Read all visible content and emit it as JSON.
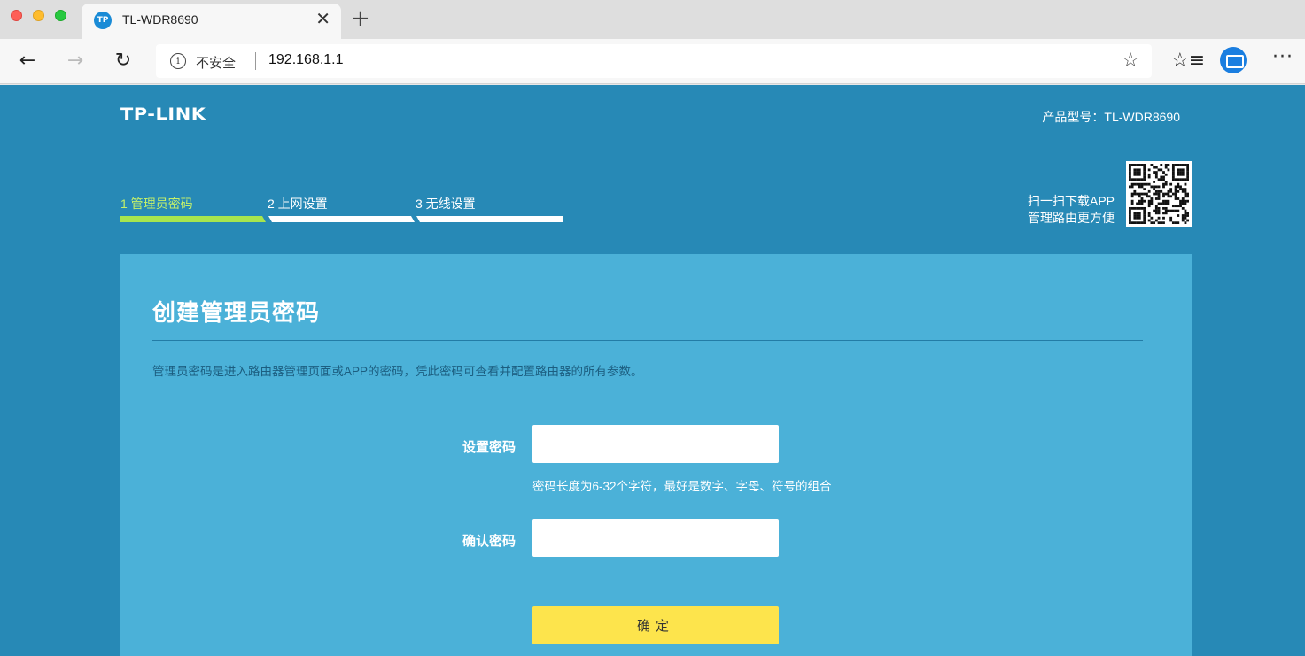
{
  "browser": {
    "tab_title": "TL-WDR8690",
    "tab_favicon_text": "TP",
    "close_glyph": "✕",
    "new_tab_glyph": "+",
    "insecure_label": "不安全",
    "url": "192.168.1.1",
    "icons": {
      "back": "←",
      "forward": "→",
      "reload": "↻",
      "info": "i",
      "star": "☆",
      "favorites_list": "☆≡",
      "more": "···"
    }
  },
  "router": {
    "logo": "TP-LINK",
    "model": "产品型号：TL-WDR8690",
    "steps": [
      {
        "label": "1 管理员密码",
        "active": true
      },
      {
        "label": "2 上网设置",
        "active": false
      },
      {
        "label": "3 无线设置",
        "active": false
      }
    ],
    "app_promo_line1": "扫一扫下载APP",
    "app_promo_line2": "管理路由更方便",
    "card": {
      "title": "创建管理员密码",
      "description": "管理员密码是进入路由器管理页面或APP的密码，凭此密码可查看并配置路由器的所有参数。",
      "password_label": "设置密码",
      "password_value": "",
      "password_hint": "密码长度为6-32个字符，最好是数字、字母、符号的组合",
      "confirm_label": "确认密码",
      "confirm_value": "",
      "submit_label": "确定"
    }
  },
  "colors": {
    "page_bg": "#2789b6",
    "card_bg": "#4bb1d8",
    "active_step": "#a6e54e",
    "button": "#fde44c"
  }
}
